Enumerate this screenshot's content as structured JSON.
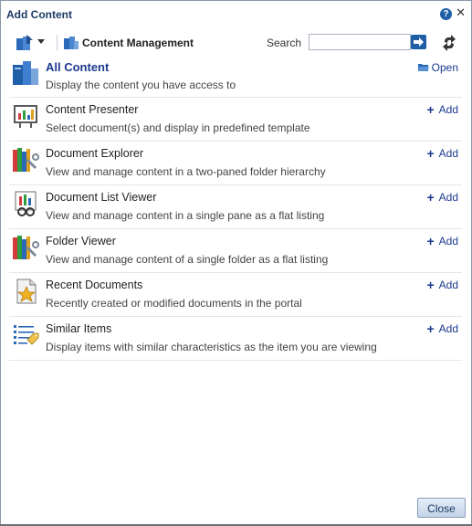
{
  "dialog": {
    "title": "Add Content",
    "help_icon": "help-icon",
    "close_label": "✕"
  },
  "toolbar": {
    "home_icon": "content-catalog-home-icon",
    "breadcrumb_label": "Content Management",
    "search_label": "Search",
    "search_value": "",
    "search_placeholder": "",
    "go_icon": "arrow-right-icon",
    "refresh_icon": "refresh-icon"
  },
  "items": [
    {
      "name": "All Content",
      "description": "Display the content you have access to",
      "action": "Open",
      "icon": "content-library-icon"
    },
    {
      "name": "Content Presenter",
      "description": "Select document(s) and display in predefined template",
      "action": "Add",
      "icon": "presentation-board-icon"
    },
    {
      "name": "Document Explorer",
      "description": "View and manage content in a two-paned folder hierarchy",
      "action": "Add",
      "icon": "books-wrench-icon"
    },
    {
      "name": "Document List Viewer",
      "description": "View and manage content in a single pane as a flat listing",
      "action": "Add",
      "icon": "document-glasses-icon"
    },
    {
      "name": "Folder Viewer",
      "description": "View and manage content of a single folder as a flat listing",
      "action": "Add",
      "icon": "books-wrench-icon"
    },
    {
      "name": "Recent Documents",
      "description": "Recently created or modified documents in the portal",
      "action": "Add",
      "icon": "document-star-icon"
    },
    {
      "name": "Similar Items",
      "description": "Display items with similar characteristics as the item you are viewing",
      "action": "Add",
      "icon": "list-tag-icon"
    }
  ],
  "footer": {
    "close_button": "Close"
  },
  "colors": {
    "accent": "#1c3a8f",
    "title": "#1c3a63",
    "button_bg": "#c3d4e8"
  }
}
